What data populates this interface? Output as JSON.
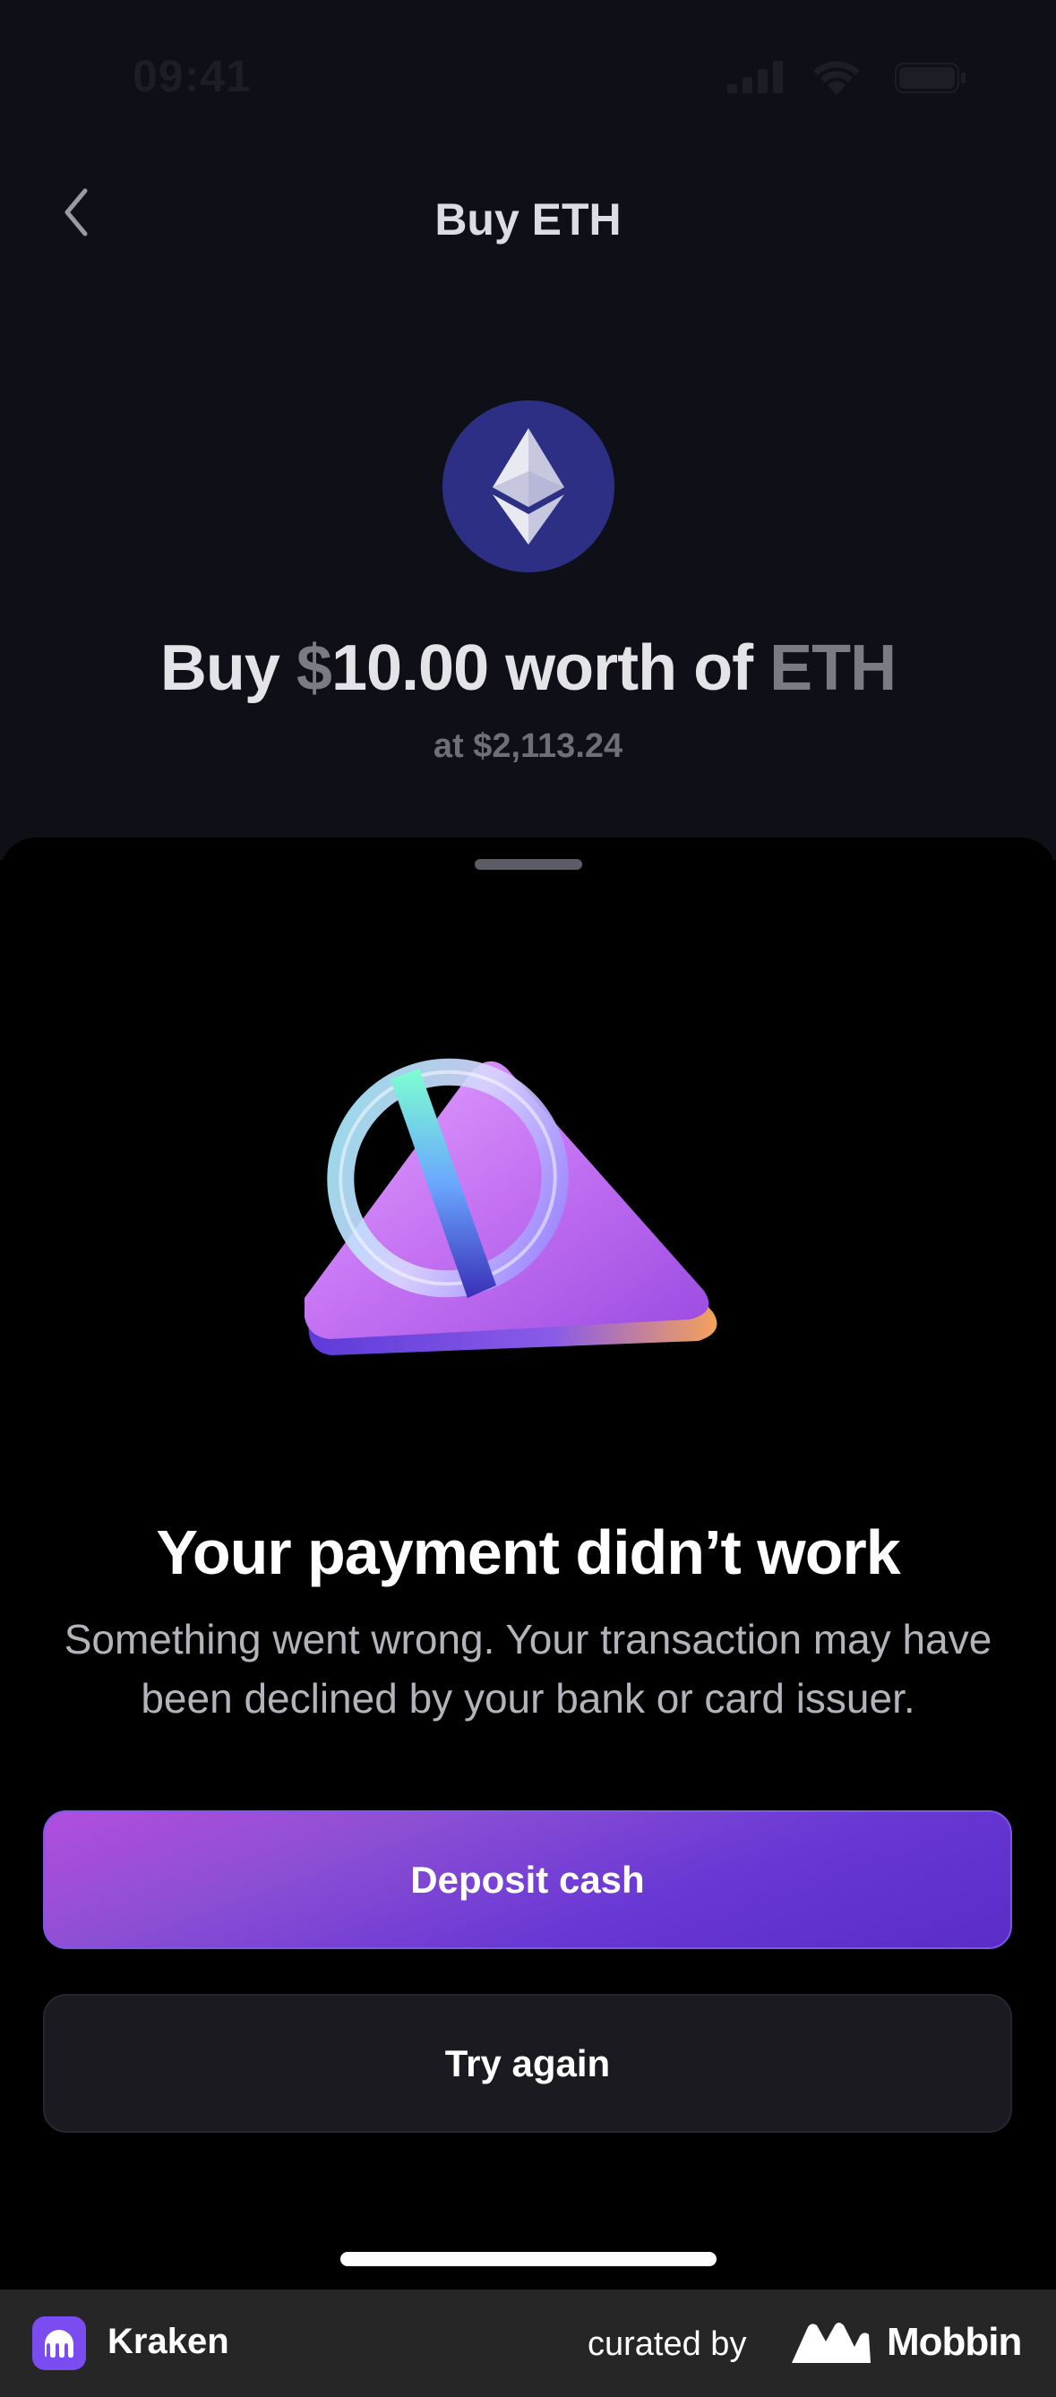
{
  "status_bar": {
    "time": "09:41",
    "icons": [
      "cellular-signal-icon",
      "wifi-icon",
      "battery-icon"
    ]
  },
  "header": {
    "title": "Buy ETH",
    "back_icon": "chevron-left-icon"
  },
  "asset": {
    "icon": "ethereum-icon",
    "prefix": "Buy ",
    "currency_symbol": "$",
    "amount": "10.00",
    "middle": " worth of ",
    "ticker": "ETH",
    "rate": "at $2,113.24"
  },
  "sheet": {
    "illustration": "payment-failed-illustration",
    "title": "Your payment didn’t work",
    "message": "Something went wrong. Your transaction may have been declined by your bank or card issuer.",
    "primary_button": "Deposit cash",
    "secondary_button": "Try again"
  },
  "footer": {
    "app_name": "Kraken",
    "curated_label": "curated by",
    "brand_name": "Mobbin"
  },
  "colors": {
    "background_top": "#0f0f17",
    "sheet_background": "#000000",
    "eth_circle": "#2c2f83",
    "primary_gradient_start": "#b24ee0",
    "primary_gradient_end": "#5a2cc8",
    "secondary_button": "#1a1a20",
    "footer_background": "#262626",
    "kraken_purple": "#7b4cf0"
  }
}
